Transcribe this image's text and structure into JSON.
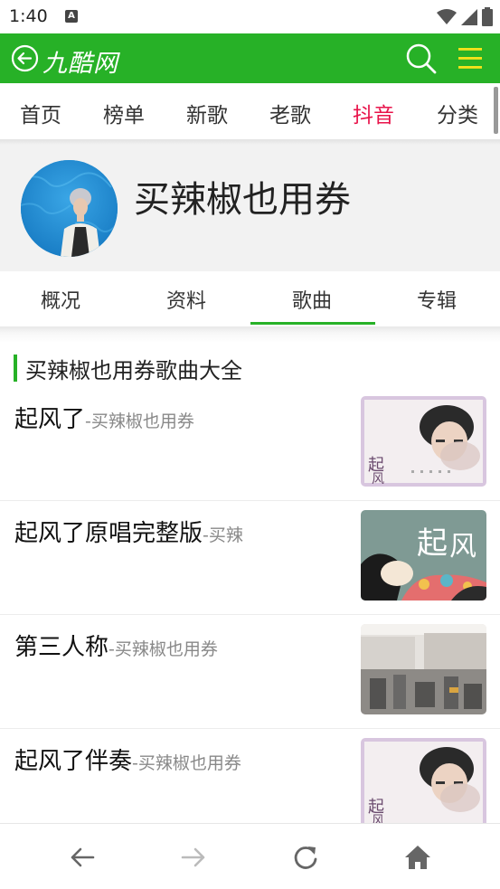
{
  "status_bar": {
    "time": "1:40",
    "notification_icon": "a-notification-icon",
    "icons": [
      "wifi-icon",
      "signal-icon",
      "battery-icon"
    ]
  },
  "header": {
    "logo_text": "九酷网",
    "brand_color": "#27b127",
    "back_icon": "back-circle-icon",
    "search_icon": "search-icon",
    "menu_icon": "hamburger-menu-icon"
  },
  "nav": {
    "items": [
      {
        "label": "首页"
      },
      {
        "label": "榜单"
      },
      {
        "label": "新歌"
      },
      {
        "label": "老歌"
      },
      {
        "label": "抖音",
        "active": true
      },
      {
        "label": "分类"
      }
    ],
    "active_color": "#e8134a"
  },
  "profile": {
    "artist_name": "买辣椒也用券"
  },
  "tabs": {
    "items": [
      {
        "label": "概况"
      },
      {
        "label": "资料"
      },
      {
        "label": "歌曲",
        "active": true
      },
      {
        "label": "专辑"
      }
    ]
  },
  "section": {
    "title": "买辣椒也用券歌曲大全"
  },
  "songs": [
    {
      "title": "起风了",
      "artist": "-买辣椒也用券"
    },
    {
      "title": "起风了原唱完整版",
      "artist": "-买辣"
    },
    {
      "title": "第三人称",
      "artist": "-买辣椒也用券"
    },
    {
      "title": "起风了伴奏",
      "artist": "-买辣椒也用券"
    }
  ],
  "bottom_bar": {
    "icons": [
      "arrow-back-icon",
      "arrow-forward-icon",
      "refresh-icon",
      "home-icon"
    ]
  }
}
